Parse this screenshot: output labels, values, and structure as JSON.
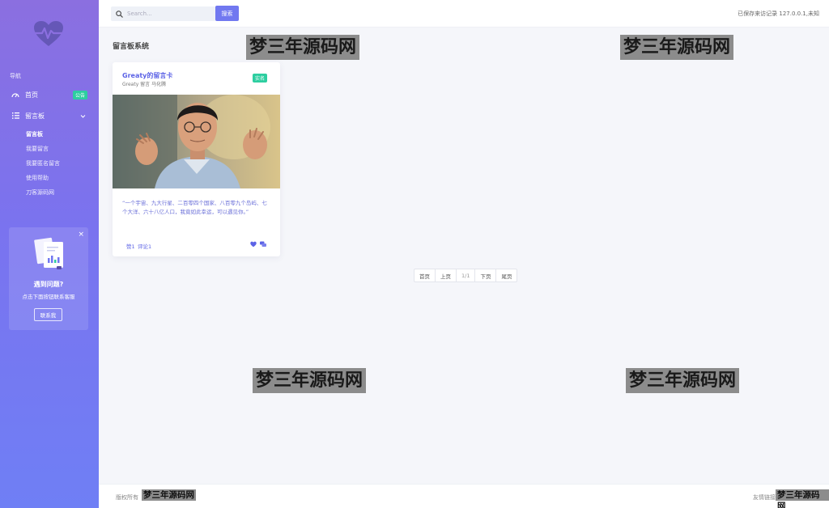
{
  "sidebar": {
    "nav_caption": "导航",
    "items": [
      {
        "label": "首页",
        "badge": "公告"
      },
      {
        "label": "留言板"
      }
    ],
    "sub_items": [
      "留言板",
      "我要留言",
      "我要匿名留言",
      "使用帮助",
      "刀客源码网"
    ],
    "help": {
      "close": "×",
      "title": "遇到问题?",
      "subtitle": "点击下面按钮联系客服",
      "button": "联系我"
    }
  },
  "header": {
    "search_placeholder": "Search...",
    "search_button": "搜索",
    "status": "已保存来访记录 127.0.0.1,未知"
  },
  "main": {
    "page_title": "留言板系统",
    "card": {
      "title": "Greaty的留言卡",
      "subtitle": "Greaty 留言 马化腾",
      "badge": "实名",
      "quote": "“一个宇宙、九大行星、二百零四个国家、八百零九个岛屿、七个大洋、六十八亿人口，我竟如此幸运，可以遇见你。”",
      "likes": "赞1",
      "comments": "评论1"
    },
    "pager": [
      "首页",
      "上页",
      "1/1",
      "下页",
      "尾页"
    ]
  },
  "watermark": "梦三年源码网",
  "footer": {
    "left": "版权所有",
    "right": "友情链接"
  },
  "colors": {
    "accent": "#7178f0",
    "badge_green": "#2dcea0",
    "sidebar_top": "#8b6fe0",
    "sidebar_bottom": "#6f7ff5"
  }
}
